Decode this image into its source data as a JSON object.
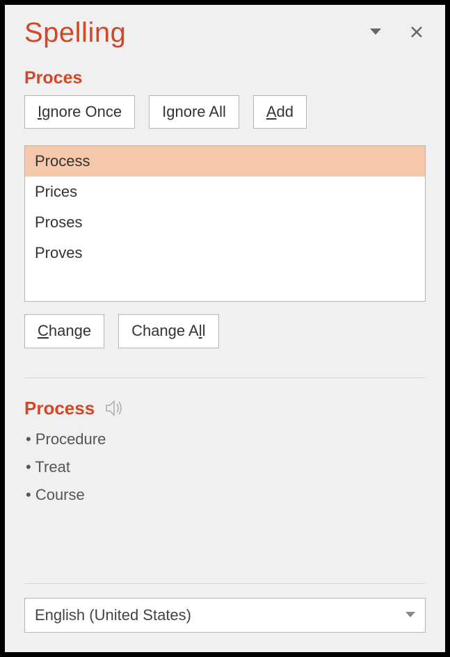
{
  "header": {
    "title": "Spelling"
  },
  "misspelled_word": "Proces",
  "buttons": {
    "ignore_once": "Ignore Once",
    "ignore_all": "Ignore All",
    "add": "Add",
    "change": "Change",
    "change_all": "Change All"
  },
  "suggestions": [
    {
      "text": "Process",
      "selected": true
    },
    {
      "text": "Prices",
      "selected": false
    },
    {
      "text": "Proses",
      "selected": false
    },
    {
      "text": "Proves",
      "selected": false
    }
  ],
  "selected_word": "Process",
  "synonyms": [
    "Procedure",
    "Treat",
    "Course"
  ],
  "language": "English (United States)"
}
